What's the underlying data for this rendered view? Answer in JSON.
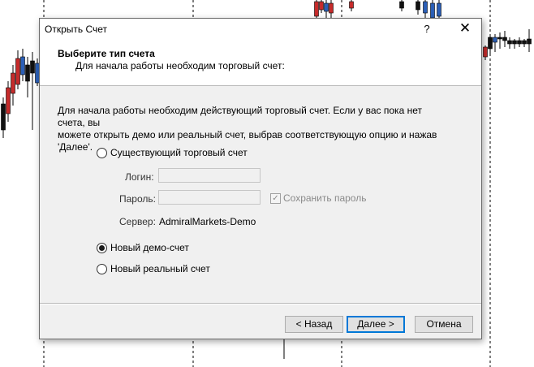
{
  "dialog": {
    "title": "Открыть Счет",
    "help_label": "?",
    "close_label": "✕",
    "header_title": "Выберите тип счета",
    "header_subtitle": "Для начала работы необходим торговый счет:",
    "intro_line1": "Для начала работы необходим действующий торговый счет. Если у вас пока нет счета, вы",
    "intro_line2": "можете открыть демо или реальный счет, выбрав соответствующую опцию и нажав 'Далее'.",
    "options": {
      "existing": {
        "label": "Существующий торговый счет",
        "selected": false
      },
      "demo": {
        "label": "Новый демо-счет",
        "selected": true
      },
      "real": {
        "label": "Новый реальный счет",
        "selected": false
      }
    },
    "login_label": "Логин:",
    "login_value": "",
    "password_label": "Пароль:",
    "password_value": "",
    "save_password_label": "Сохранить пароль",
    "save_password_checked": true,
    "server_label": "Сервер:",
    "server_value": "AdmiralMarkets-Demo",
    "buttons": {
      "back": "< Назад",
      "next": "Далее >",
      "cancel": "Отмена"
    }
  },
  "colors": {
    "bull_candle": "#2b5fb7",
    "bear_candle": "#c62b2b",
    "dialog_bg": "#f0f0f0",
    "default_button_border": "#0078d7"
  },
  "icons": {
    "close": "close-icon",
    "help": "help-icon",
    "check": "checkmark-icon"
  }
}
